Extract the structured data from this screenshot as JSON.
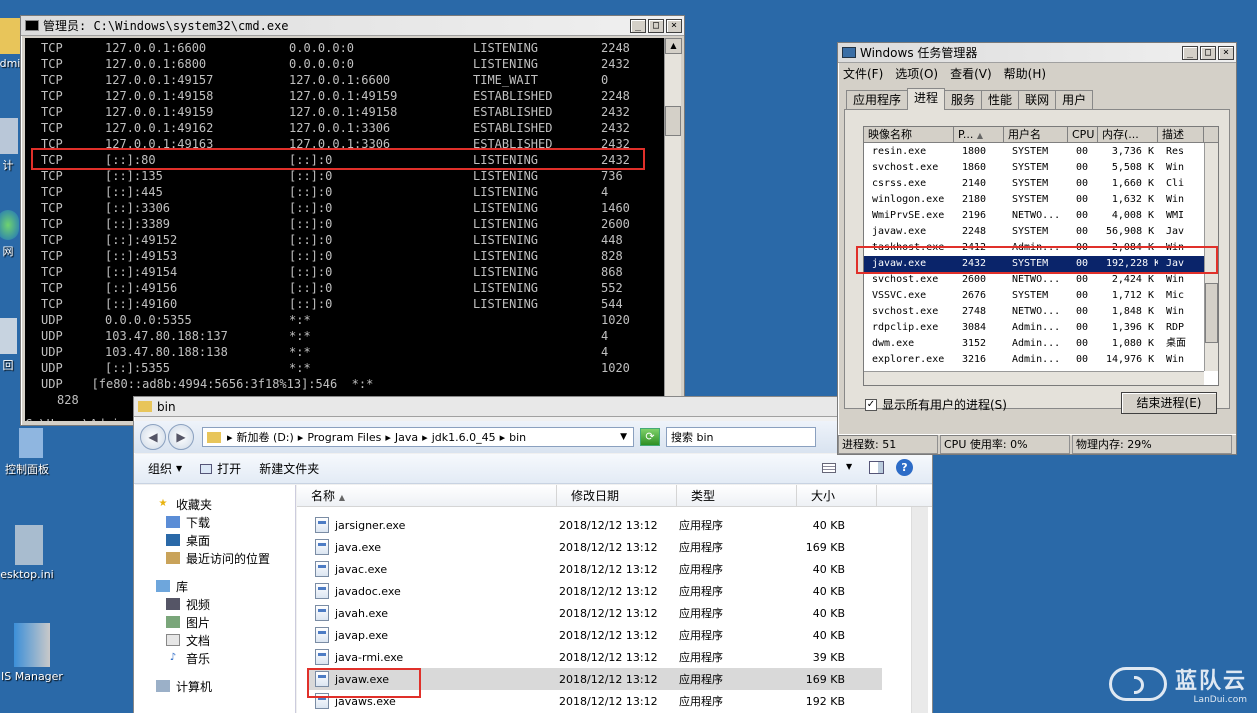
{
  "desktop": {
    "icons": [
      {
        "label": "dmi"
      },
      {
        "label": "计"
      },
      {
        "label": "网"
      },
      {
        "label": "回"
      },
      {
        "label": "控制面板"
      },
      {
        "label": "esktop.ini"
      },
      {
        "label": "IS Manager"
      }
    ]
  },
  "cmd": {
    "title": "管理员: C:\\Windows\\system32\\cmd.exe",
    "rows": [
      {
        "proto": "TCP",
        "local": "127.0.0.1:6600",
        "foreign": "0.0.0.0:0",
        "state": "LISTENING",
        "pid": "2248"
      },
      {
        "proto": "TCP",
        "local": "127.0.0.1:6800",
        "foreign": "0.0.0.0:0",
        "state": "LISTENING",
        "pid": "2432"
      },
      {
        "proto": "TCP",
        "local": "127.0.0.1:49157",
        "foreign": "127.0.0.1:6600",
        "state": "TIME_WAIT",
        "pid": "0"
      },
      {
        "proto": "TCP",
        "local": "127.0.0.1:49158",
        "foreign": "127.0.0.1:49159",
        "state": "ESTABLISHED",
        "pid": "2248"
      },
      {
        "proto": "TCP",
        "local": "127.0.0.1:49159",
        "foreign": "127.0.0.1:49158",
        "state": "ESTABLISHED",
        "pid": "2432"
      },
      {
        "proto": "TCP",
        "local": "127.0.0.1:49162",
        "foreign": "127.0.0.1:3306",
        "state": "ESTABLISHED",
        "pid": "2432"
      },
      {
        "proto": "TCP",
        "local": "127.0.0.1:49163",
        "foreign": "127.0.0.1:3306",
        "state": "ESTABLISHED",
        "pid": "2432"
      },
      {
        "proto": "TCP",
        "local": "[::]:80",
        "foreign": "[::]:0",
        "state": "LISTENING",
        "pid": "2432"
      },
      {
        "proto": "TCP",
        "local": "[::]:135",
        "foreign": "[::]:0",
        "state": "LISTENING",
        "pid": "736"
      },
      {
        "proto": "TCP",
        "local": "[::]:445",
        "foreign": "[::]:0",
        "state": "LISTENING",
        "pid": "4"
      },
      {
        "proto": "TCP",
        "local": "[::]:3306",
        "foreign": "[::]:0",
        "state": "LISTENING",
        "pid": "1460"
      },
      {
        "proto": "TCP",
        "local": "[::]:3389",
        "foreign": "[::]:0",
        "state": "LISTENING",
        "pid": "2600"
      },
      {
        "proto": "TCP",
        "local": "[::]:49152",
        "foreign": "[::]:0",
        "state": "LISTENING",
        "pid": "448"
      },
      {
        "proto": "TCP",
        "local": "[::]:49153",
        "foreign": "[::]:0",
        "state": "LISTENING",
        "pid": "828"
      },
      {
        "proto": "TCP",
        "local": "[::]:49154",
        "foreign": "[::]:0",
        "state": "LISTENING",
        "pid": "868"
      },
      {
        "proto": "TCP",
        "local": "[::]:49156",
        "foreign": "[::]:0",
        "state": "LISTENING",
        "pid": "552"
      },
      {
        "proto": "TCP",
        "local": "[::]:49160",
        "foreign": "[::]:0",
        "state": "LISTENING",
        "pid": "544"
      },
      {
        "proto": "UDP",
        "local": "0.0.0.0:5355",
        "foreign": "*:*",
        "state": "",
        "pid": "1020"
      },
      {
        "proto": "UDP",
        "local": "103.47.80.188:137",
        "foreign": "*:*",
        "state": "",
        "pid": "4"
      },
      {
        "proto": "UDP",
        "local": "103.47.80.188:138",
        "foreign": "*:*",
        "state": "",
        "pid": "4"
      },
      {
        "proto": "UDP",
        "local": "[::]:5355",
        "foreign": "*:*",
        "state": "",
        "pid": "1020"
      }
    ],
    "long_line": "UDP    [fe80::ad8b:4994:5656:3f18%13]:546  *:*",
    "wrap_line": "828",
    "prompt": "C:\\Users\\Admin"
  },
  "explorer": {
    "title": "bin",
    "breadcrumb": [
      "新加卷 (D:)",
      "Program Files",
      "Java",
      "jdk1.6.0_45",
      "bin"
    ],
    "search_placeholder": "搜索 bin",
    "toolbar": {
      "organize": "组织",
      "open": "打开",
      "new_folder": "新建文件夹"
    },
    "nav": {
      "favorites": "收藏夹",
      "downloads": "下载",
      "desktop": "桌面",
      "recent": "最近访问的位置",
      "library": "库",
      "videos": "视频",
      "pictures": "图片",
      "documents": "文档",
      "music": "音乐",
      "computer": "计算机"
    },
    "columns": {
      "name": "名称",
      "date": "修改日期",
      "type": "类型",
      "size": "大小"
    },
    "files": [
      {
        "name": "jarsigner.exe",
        "date": "2018/12/12 13:12",
        "type": "应用程序",
        "size": "40 KB"
      },
      {
        "name": "java.exe",
        "date": "2018/12/12 13:12",
        "type": "应用程序",
        "size": "169 KB"
      },
      {
        "name": "javac.exe",
        "date": "2018/12/12 13:12",
        "type": "应用程序",
        "size": "40 KB"
      },
      {
        "name": "javadoc.exe",
        "date": "2018/12/12 13:12",
        "type": "应用程序",
        "size": "40 KB"
      },
      {
        "name": "javah.exe",
        "date": "2018/12/12 13:12",
        "type": "应用程序",
        "size": "40 KB"
      },
      {
        "name": "javap.exe",
        "date": "2018/12/12 13:12",
        "type": "应用程序",
        "size": "40 KB"
      },
      {
        "name": "java-rmi.exe",
        "date": "2018/12/12 13:12",
        "type": "应用程序",
        "size": "39 KB"
      },
      {
        "name": "javaw.exe",
        "date": "2018/12/12 13:12",
        "type": "应用程序",
        "size": "169 KB"
      },
      {
        "name": "javaws.exe",
        "date": "2018/12/12 13:12",
        "type": "应用程序",
        "size": "192 KB"
      }
    ]
  },
  "taskmgr": {
    "title": "Windows 任务管理器",
    "menu": [
      "文件(F)",
      "选项(O)",
      "查看(V)",
      "帮助(H)"
    ],
    "tabs": [
      "应用程序",
      "进程",
      "服务",
      "性能",
      "联网",
      "用户"
    ],
    "columns": [
      "映像名称",
      "P...",
      "用户名",
      "CPU",
      "内存(...",
      "描述"
    ],
    "processes": [
      {
        "name": "resin.exe",
        "pid": "1800",
        "user": "SYSTEM",
        "cpu": "00",
        "mem": "3,736 K",
        "desc": "Res"
      },
      {
        "name": "svchost.exe",
        "pid": "1860",
        "user": "SYSTEM",
        "cpu": "00",
        "mem": "5,508 K",
        "desc": "Win"
      },
      {
        "name": "csrss.exe",
        "pid": "2140",
        "user": "SYSTEM",
        "cpu": "00",
        "mem": "1,660 K",
        "desc": "Cli"
      },
      {
        "name": "winlogon.exe",
        "pid": "2180",
        "user": "SYSTEM",
        "cpu": "00",
        "mem": "1,632 K",
        "desc": "Win"
      },
      {
        "name": "WmiPrvSE.exe",
        "pid": "2196",
        "user": "NETWO...",
        "cpu": "00",
        "mem": "4,008 K",
        "desc": "WMI"
      },
      {
        "name": "javaw.exe",
        "pid": "2248",
        "user": "SYSTEM",
        "cpu": "00",
        "mem": "56,908 K",
        "desc": "Jav"
      },
      {
        "name": "taskhost.exe",
        "pid": "2412",
        "user": "Admin...",
        "cpu": "00",
        "mem": "2,084 K",
        "desc": "Win"
      },
      {
        "name": "javaw.exe",
        "pid": "2432",
        "user": "SYSTEM",
        "cpu": "00",
        "mem": "192,228 K",
        "desc": "Jav"
      },
      {
        "name": "svchost.exe",
        "pid": "2600",
        "user": "NETWO...",
        "cpu": "00",
        "mem": "2,424 K",
        "desc": "Win"
      },
      {
        "name": "VSSVC.exe",
        "pid": "2676",
        "user": "SYSTEM",
        "cpu": "00",
        "mem": "1,712 K",
        "desc": "Mic"
      },
      {
        "name": "svchost.exe",
        "pid": "2748",
        "user": "NETWO...",
        "cpu": "00",
        "mem": "1,848 K",
        "desc": "Win"
      },
      {
        "name": "rdpclip.exe",
        "pid": "3084",
        "user": "Admin...",
        "cpu": "00",
        "mem": "1,396 K",
        "desc": "RDP"
      },
      {
        "name": "dwm.exe",
        "pid": "3152",
        "user": "Admin...",
        "cpu": "00",
        "mem": "1,080 K",
        "desc": "桌面"
      },
      {
        "name": "explorer.exe",
        "pid": "3216",
        "user": "Admin...",
        "cpu": "00",
        "mem": "14,976 K",
        "desc": "Win"
      }
    ],
    "show_all_label": "显示所有用户的进程(S)",
    "end_process_label": "结束进程(E)",
    "status": {
      "procs": "进程数: 51",
      "cpu": "CPU 使用率: 0%",
      "mem": "物理内存: 29%"
    }
  },
  "watermark": {
    "text": "蓝队云",
    "sub": "LanDui.com"
  },
  "colors": {
    "highlight": "#e0302a",
    "selection": "#0a246a",
    "desktop": "#2a69a8"
  }
}
